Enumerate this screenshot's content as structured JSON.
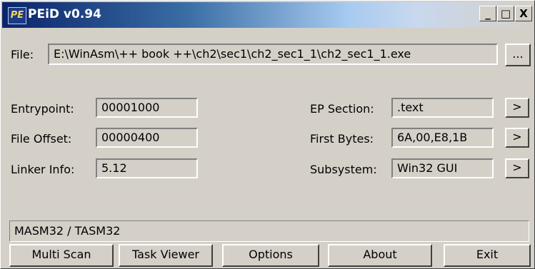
{
  "window": {
    "title": "PEiD v0.94",
    "icon_glyph": "PE",
    "controls": {
      "minimize": "_",
      "maximize": "□",
      "close": "X"
    }
  },
  "file": {
    "label": "File:",
    "value": "E:\\WinAsm\\++  book ++\\ch2\\sec1\\ch2_sec1_1\\ch2_sec1_1.exe",
    "browse_label": "..."
  },
  "info": {
    "entrypoint": {
      "label": "Entrypoint:",
      "value": "00001000"
    },
    "file_offset": {
      "label": "File Offset:",
      "value": "00000400"
    },
    "linker_info": {
      "label": "Linker Info:",
      "value": "5.12"
    },
    "ep_section": {
      "label": "EP Section:",
      "value": ".text",
      "button": ">"
    },
    "first_bytes": {
      "label": "First Bytes:",
      "value": "6A,00,E8,1B",
      "button": ">"
    },
    "subsystem": {
      "label": "Subsystem:",
      "value": "Win32 GUI",
      "button": ">"
    }
  },
  "status": {
    "text": "MASM32 / TASM32"
  },
  "buttons": {
    "multi_scan": "Multi Scan",
    "task_viewer": "Task Viewer",
    "options": "Options",
    "about": "About",
    "exit": "Exit"
  },
  "colors": {
    "face": "#d4d0c8",
    "title_active": "#0a246a"
  }
}
